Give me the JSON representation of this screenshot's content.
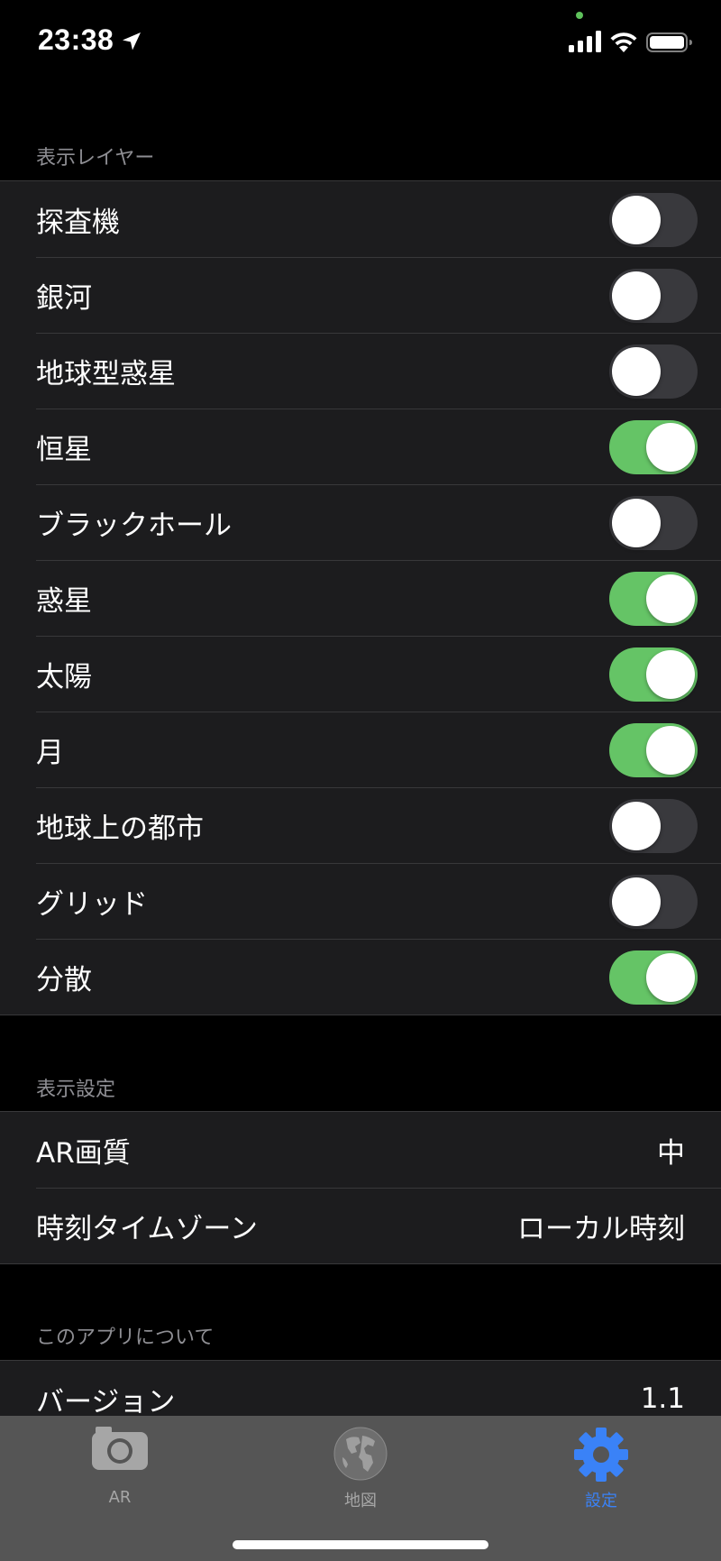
{
  "status_bar": {
    "time": "23:38",
    "privacy_indicator_color": "#5ec15b"
  },
  "colors": {
    "toggle_on": "#65c466",
    "toggle_off": "#39393d",
    "accent": "#3a82f7",
    "section_header": "#8e8e93"
  },
  "layers_section": {
    "header": "表示レイヤー",
    "items": [
      {
        "label": "探査機",
        "on": false
      },
      {
        "label": "銀河",
        "on": false
      },
      {
        "label": "地球型惑星",
        "on": false
      },
      {
        "label": "恒星",
        "on": true
      },
      {
        "label": "ブラックホール",
        "on": false
      },
      {
        "label": "惑星",
        "on": true
      },
      {
        "label": "太陽",
        "on": true
      },
      {
        "label": "月",
        "on": true
      },
      {
        "label": "地球上の都市",
        "on": false
      },
      {
        "label": "グリッド",
        "on": false
      },
      {
        "label": "分散",
        "on": true
      }
    ]
  },
  "display_section": {
    "header": "表示設定",
    "items": [
      {
        "label": "AR画質",
        "value": "中"
      },
      {
        "label": "時刻タイムゾーン",
        "value": "ローカル時刻"
      }
    ]
  },
  "about_section": {
    "header": "このアプリについて",
    "items": [
      {
        "label": "バージョン",
        "value": "1.1"
      }
    ]
  },
  "tab_bar": {
    "tabs": [
      {
        "label": "AR",
        "icon": "camera-icon",
        "active": false
      },
      {
        "label": "地図",
        "icon": "globe-icon",
        "active": false
      },
      {
        "label": "設定",
        "icon": "gear-icon",
        "active": true
      }
    ]
  }
}
